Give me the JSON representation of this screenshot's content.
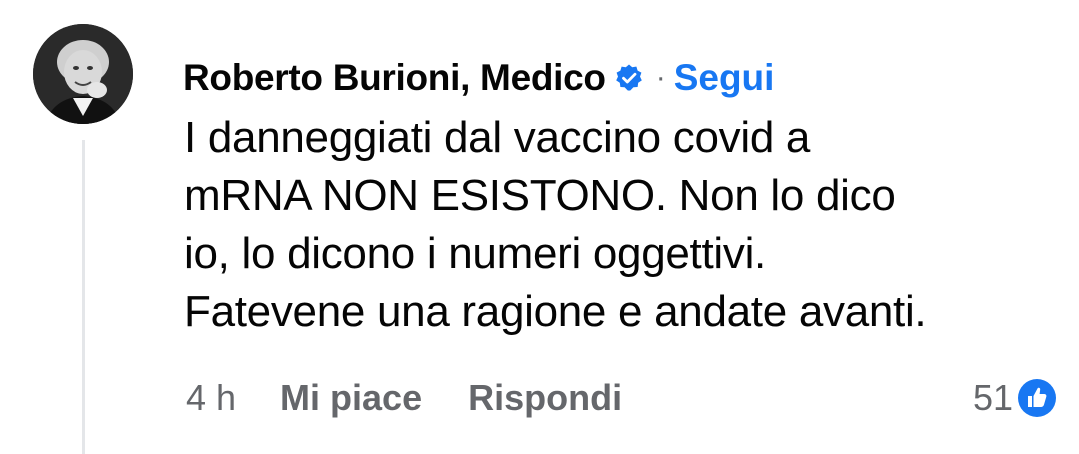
{
  "comment": {
    "author": "Roberto Burioni, Medico",
    "separator": "·",
    "follow_label": "Segui",
    "text_lines": [
      "I danneggiati dal vaccino covid a",
      "mRNA NON ESISTONO. Non lo dico",
      "io, lo dicono i numeri oggettivi.",
      "Fatevene una ragione e andate avanti."
    ],
    "timestamp": "4 h",
    "like_label": "Mi piace",
    "reply_label": "Rispondi",
    "reaction_count": "51"
  },
  "icons": {
    "avatar": "profile-photo",
    "verified": "verified-badge-icon",
    "reaction": "like-reaction-icon"
  },
  "colors": {
    "accent": "#1877f2",
    "muted": "#65676b",
    "text": "#050505"
  }
}
